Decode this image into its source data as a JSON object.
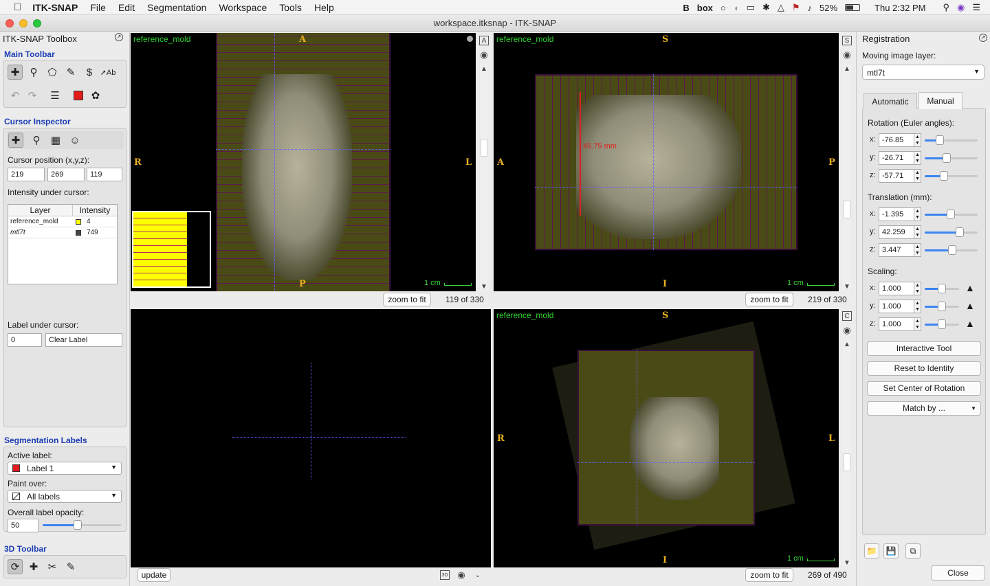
{
  "menubar": {
    "app": "ITK-SNAP",
    "items": [
      "File",
      "Edit",
      "Segmentation",
      "Workspace",
      "Tools",
      "Help"
    ],
    "status": {
      "battery": "52%",
      "clock": "Thu 2:32 PM"
    }
  },
  "window": {
    "title": "workspace.itksnap - ITK-SNAP"
  },
  "toolbox": {
    "title": "ITK-SNAP Toolbox",
    "main_toolbar": "Main Toolbar",
    "cursor_inspector": "Cursor Inspector",
    "cursor_position_label": "Cursor position (x,y,z):",
    "cursor_x": "219",
    "cursor_y": "269",
    "cursor_z": "119",
    "intensity_label": "Intensity under cursor:",
    "table_headers": [
      "Layer",
      "Intensity"
    ],
    "rows": [
      {
        "layer": "reference_mold",
        "value": "4",
        "swatch": "#ffff00"
      },
      {
        "layer": "mtl7t",
        "value": "749",
        "swatch": "#444444"
      }
    ],
    "label_under_cursor": "Label under cursor:",
    "label_id": "0",
    "label_name": "Clear Label",
    "seg_labels_title": "Segmentation Labels",
    "active_label_title": "Active label:",
    "active_label": "Label 1",
    "active_label_color": "#e41b1b",
    "paint_over_title": "Paint over:",
    "paint_over": "All labels",
    "opacity_title": "Overall label opacity:",
    "opacity_value": "50",
    "opacity_fraction": 0.45,
    "toolbar3d": "3D Toolbar"
  },
  "views": {
    "axial": {
      "layer": "reference_mold",
      "top": "A",
      "bottom": "P",
      "left": "R",
      "right": "L",
      "scale": "1 cm",
      "zoom": "zoom to fit",
      "slice": "119 of 330"
    },
    "sagittal": {
      "layer": "reference_mold",
      "top": "S",
      "bottom": "I",
      "left": "A",
      "right": "P",
      "scale": "1 cm",
      "zoom": "zoom to fit",
      "slice": "219 of 330",
      "measure": "45.75 mm"
    },
    "coronal": {
      "layer": "reference_mold",
      "top": "S",
      "bottom": "I",
      "left": "R",
      "right": "L",
      "scale": "1 cm",
      "zoom": "zoom to fit",
      "slice": "269 of 490"
    },
    "three_d": {
      "update": "update"
    }
  },
  "registration": {
    "title": "Registration",
    "moving_label": "Moving image layer:",
    "moving_value": "mtl7t",
    "tabs": [
      "Automatic",
      "Manual"
    ],
    "active_tab": "Manual",
    "rotation_title": "Rotation (Euler angles):",
    "rotation": [
      {
        "axis": "x:",
        "value": "-76.85",
        "fraction": 0.28
      },
      {
        "axis": "y:",
        "value": "-26.71",
        "fraction": 0.42
      },
      {
        "axis": "z:",
        "value": "-57.71",
        "fraction": 0.36
      }
    ],
    "translation_title": "Translation (mm):",
    "translation": [
      {
        "axis": "x:",
        "value": "-1.395",
        "fraction": 0.49
      },
      {
        "axis": "y:",
        "value": "42.259",
        "fraction": 0.66
      },
      {
        "axis": "z:",
        "value": "3.447",
        "fraction": 0.52
      }
    ],
    "scaling_title": "Scaling:",
    "scaling": [
      {
        "axis": "x:",
        "value": "1.000",
        "fraction": 0.5
      },
      {
        "axis": "y:",
        "value": "1.000",
        "fraction": 0.5
      },
      {
        "axis": "z:",
        "value": "1.000",
        "fraction": 0.5
      }
    ],
    "buttons": {
      "interactive": "Interactive Tool",
      "reset": "Reset to Identity",
      "center": "Set Center of Rotation",
      "match": "Match by ..."
    },
    "close": "Close"
  }
}
